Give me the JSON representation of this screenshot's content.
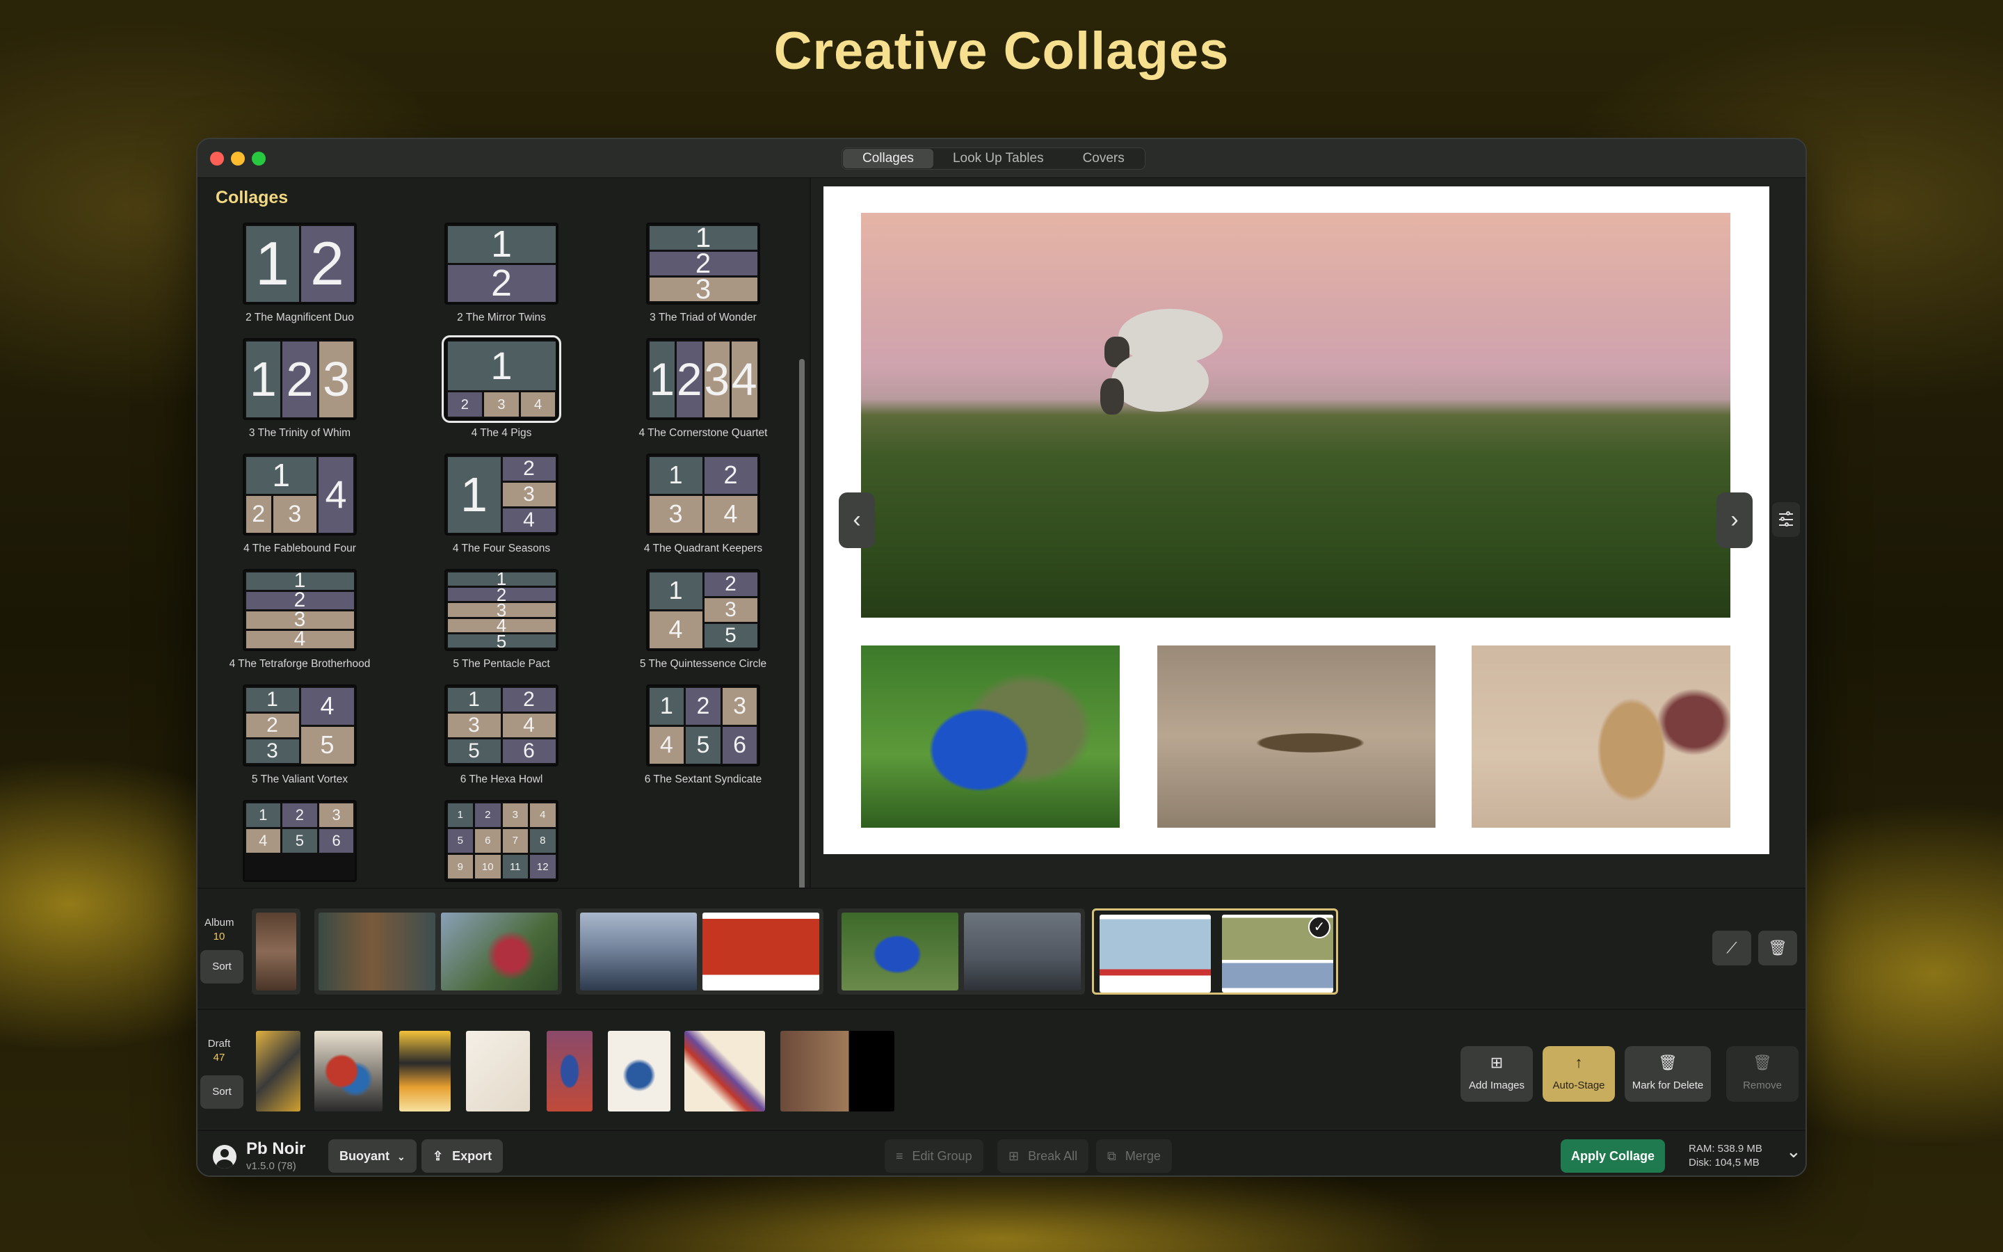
{
  "hero": {
    "title": "Creative Collages"
  },
  "window": {
    "tabs": [
      {
        "label": "Collages",
        "active": true
      },
      {
        "label": "Look Up Tables",
        "active": false
      },
      {
        "label": "Covers",
        "active": false
      }
    ]
  },
  "collages_panel": {
    "title": "Collages",
    "items": [
      {
        "name": "2 The Magnificent Duo",
        "tiles": [
          "1",
          "2"
        ]
      },
      {
        "name": "2 The Mirror Twins",
        "tiles": [
          "1",
          "2"
        ]
      },
      {
        "name": "3 The Triad of Wonder",
        "tiles": [
          "1",
          "2",
          "3"
        ]
      },
      {
        "name": "3 The Trinity of Whim",
        "tiles": [
          "1",
          "2",
          "3"
        ]
      },
      {
        "name": "4 The 4 Pigs",
        "tiles": [
          "1",
          "2",
          "3",
          "4"
        ],
        "selected": true
      },
      {
        "name": "4 The Cornerstone Quartet",
        "tiles": [
          "1",
          "2",
          "3",
          "4"
        ]
      },
      {
        "name": "4 The Fablebound Four",
        "tiles": [
          "1",
          "2",
          "3",
          "4"
        ]
      },
      {
        "name": "4 The Four Seasons",
        "tiles": [
          "1",
          "2",
          "3",
          "4"
        ]
      },
      {
        "name": "4 The Quadrant Keepers",
        "tiles": [
          "1",
          "2",
          "3",
          "4"
        ]
      },
      {
        "name": "4 The Tetraforge Brotherhood",
        "tiles": [
          "1",
          "2",
          "3",
          "4"
        ]
      },
      {
        "name": "5 The Pentacle Pact",
        "tiles": [
          "1",
          "2",
          "3",
          "4",
          "5"
        ]
      },
      {
        "name": "5 The Quintessence Circle",
        "tiles": [
          "1",
          "2",
          "3",
          "4",
          "5"
        ]
      },
      {
        "name": "5 The Valiant Vortex",
        "tiles": [
          "1",
          "2",
          "3",
          "4",
          "5"
        ]
      },
      {
        "name": "6 The Hexa Howl",
        "tiles": [
          "1",
          "2",
          "3",
          "4",
          "5",
          "6"
        ]
      },
      {
        "name": "6 The Sextant Syndicate",
        "tiles": [
          "1",
          "2",
          "3",
          "4",
          "5",
          "6"
        ]
      },
      {
        "name": "",
        "tiles": [
          "1",
          "2",
          "3",
          "4",
          "5",
          "6"
        ]
      },
      {
        "name": "",
        "tiles": [
          "1",
          "2",
          "3",
          "4",
          "5",
          "6",
          "7",
          "8",
          "9",
          "10",
          "11",
          "12"
        ]
      }
    ]
  },
  "album": {
    "label": "Album",
    "count": "10",
    "sort_label": "Sort"
  },
  "draft": {
    "label": "Draft",
    "count": "47",
    "sort_label": "Sort"
  },
  "actions": {
    "add_images": "Add Images",
    "auto_stage": "Auto-Stage",
    "mark_for_delete": "Mark for Delete",
    "remove": "Remove"
  },
  "footer": {
    "app_name": "Pb Noir",
    "version": "v1.5.0 (78)",
    "preset": "Buoyant",
    "export": "Export",
    "edit_group": "Edit Group",
    "break_all": "Break All",
    "merge": "Merge",
    "apply": "Apply Collage",
    "ram": "RAM: 538.9 MB",
    "disk": "Disk: 104,5 MB"
  },
  "colors": {
    "accent_gold": "#f3d782",
    "apply_green": "#1f7a4f",
    "tile_slate": "#4f5f61",
    "tile_violet": "#5d5a72",
    "tile_tan": "#a99683"
  }
}
